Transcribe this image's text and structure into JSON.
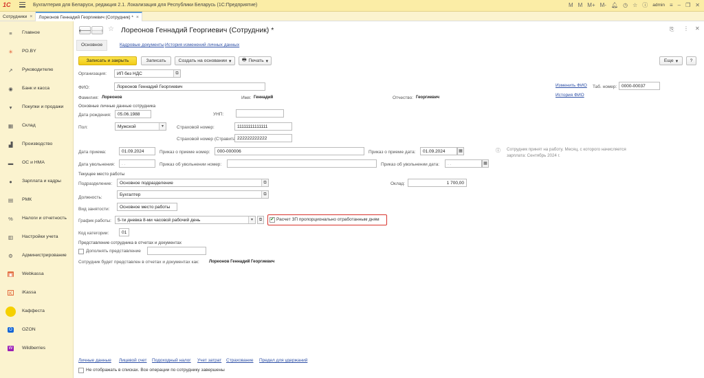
{
  "titlebar": {
    "logo": "1С",
    "app_title": "Бухгалтерия для Беларуси, редакция 2.1. Локализация для Республики Беларусь   (1С:Предприятие)",
    "user": "admin",
    "icons": [
      "M",
      "M",
      "M+",
      "M-",
      "bell-icon",
      "history-icon",
      "star-icon",
      "info-icon",
      "menu-icon",
      "minimize-icon",
      "restore-icon",
      "close-icon"
    ]
  },
  "tabs": [
    {
      "label": "Сотрудники",
      "active": false
    },
    {
      "label": "Лореонов Геннадий Георгиевич (Сотрудник) *",
      "active": true
    }
  ],
  "sidebar": {
    "items": [
      {
        "label": "Главное",
        "icon": "menu-icon"
      },
      {
        "label": "РО.BY",
        "icon": "sun-icon"
      },
      {
        "label": "Руководителю",
        "icon": "trend-icon"
      },
      {
        "label": "Банк и касса",
        "icon": "bank-icon"
      },
      {
        "label": "Покупки и продажи",
        "icon": "cart-icon"
      },
      {
        "label": "Склад",
        "icon": "warehouse-icon"
      },
      {
        "label": "Производство",
        "icon": "factory-icon"
      },
      {
        "label": "ОС и НМА",
        "icon": "car-icon"
      },
      {
        "label": "Зарплата и кадры",
        "icon": "person-icon"
      },
      {
        "label": "РМК",
        "icon": "pos-icon"
      },
      {
        "label": "Налоги и отчетность",
        "icon": "tax-icon"
      },
      {
        "label": "Настройки учета",
        "icon": "book-icon"
      },
      {
        "label": "Администрирование",
        "icon": "gear-icon"
      },
      {
        "label": "Webkassa",
        "icon": "webkassa-icon"
      },
      {
        "label": "iKassa",
        "icon": "ikassa-icon"
      },
      {
        "label": "Каффеста",
        "icon": "kaffesta-icon"
      },
      {
        "label": "OZON",
        "icon": "ozon-icon"
      },
      {
        "label": "Wildberries",
        "icon": "wildberries-icon"
      }
    ]
  },
  "header": {
    "title": "Лореонов Геннадий Георгиевич (Сотрудник) *",
    "tabs": [
      "Основное",
      "Кадровые документы",
      "История изменений личных данных"
    ]
  },
  "toolbar": {
    "save_close": "Записать и закрыть",
    "save": "Записать",
    "create_based": "Создать на основании",
    "print": "Печать",
    "more": "Еще",
    "help": "?"
  },
  "form": {
    "org_label": "Организация:",
    "org_value": "ИП без НДС",
    "fio_label": "ФИО:",
    "fio_value": "Лореонов Геннадий Георгиевич",
    "change_fio": "Изменить ФИО",
    "fio_history": "История ФИО",
    "tab_number_label": "Таб. номер:",
    "tab_number_value": "0000-00037",
    "surname_label": "Фамилия:",
    "surname_value": "Лореонов",
    "name_label": "Имя:",
    "name_value": "Геннадий",
    "patronymic_label": "Отчество:",
    "patronymic_value": "Георгиевич",
    "personal_section": "Основные личные данные сотрудника",
    "birth_label": "Дата рождения:",
    "birth_value": "05.06.1988",
    "unp_label": "УНП:",
    "unp_value": "",
    "gender_label": "Пол:",
    "gender_value": "Мужской",
    "insurance_label": "Страховой номер:",
    "insurance_value": "11111111111111",
    "insurance_stravita_label": "Страховой номер (Стравита):",
    "insurance_stravita_value": "222222222222",
    "hire_date_label": "Дата приема:",
    "hire_date_value": "01.09.2024",
    "hire_order_label": "Приказ о приеме номер:",
    "hire_order_value": "000-000006",
    "hire_order_date_label": "Приказ о приеме дата:",
    "hire_order_date_value": "01.09.2024",
    "info_text_1": "Сотрудник принят на работу. Месяц, с которого начисляется",
    "info_text_2": "зарплата: Сентябрь 2024 г.",
    "dismiss_date_label": "Дата увольнения:",
    "dismiss_date_value": ". .",
    "dismiss_order_label": "Приказ об увольнении номер:",
    "dismiss_order_value": "",
    "dismiss_order_date_label": "Приказ об увольнении дата:",
    "dismiss_order_date_value": ". .",
    "workplace_section": "Текущее место работы",
    "department_label": "Подразделение:",
    "department_value": "Основное подразделение",
    "salary_label": "Оклад:",
    "salary_value": "1 700,00",
    "position_label": "Должность:",
    "position_value": "Бухгалтер",
    "employment_label": "Вид занятости:",
    "employment_value": "Основное место работы",
    "schedule_label": "График работы:",
    "schedule_value": "5-ти дневка 8-ми часовой рабочий день",
    "prorate_label": "Расчет ЗП пропорционально отработанным дням",
    "category_label": "Код категории:",
    "category_value": "01",
    "representation_section": "Представление сотрудника в отчетах и документах",
    "supplement_label": "Дополнять представление",
    "supplement_value": "",
    "represented_label": "Сотрудник будет представлен в отчетах и документах как:",
    "represented_value": "Лореонов Геннадий Георгиевич"
  },
  "footer": {
    "links": [
      "Личные данные",
      "Лицевой счет",
      "Подоходный налог",
      "Учет затрат",
      "Страхование",
      "Предел для удержаний"
    ],
    "hide_label": "Не отображать в списках. Все операции по сотруднику завершены"
  }
}
